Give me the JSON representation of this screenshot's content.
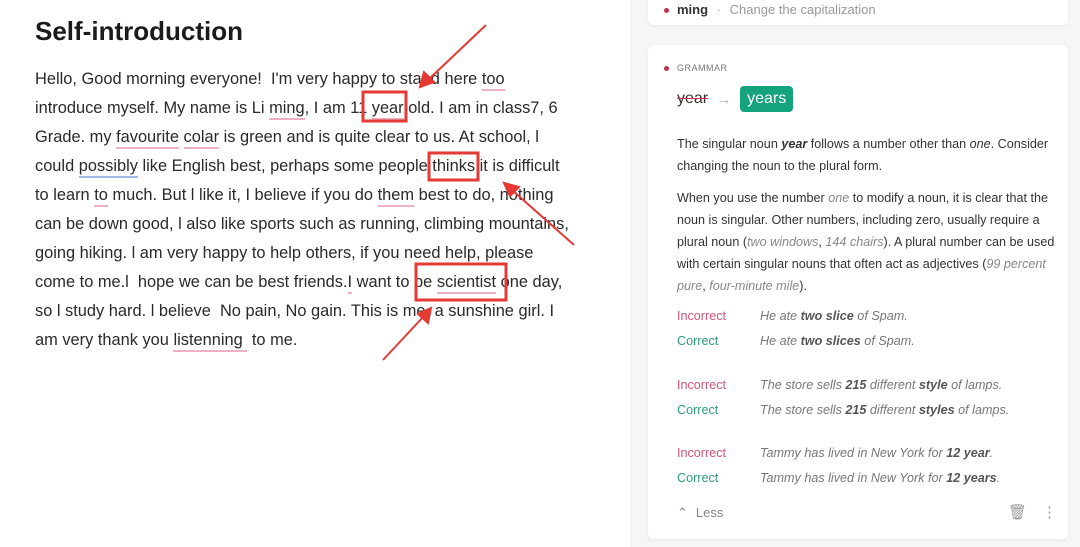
{
  "document": {
    "title": "Self-introduction",
    "lines": [
      [
        {
          "t": "Hello, Good morning everyone!  I'm very happy to stand here "
        },
        {
          "t": "too",
          "m": "red"
        }
      ],
      [
        {
          "t": "introduce myself. My name is Li "
        },
        {
          "t": "ming",
          "m": "red"
        },
        {
          "t": ", I am 11 "
        },
        {
          "t": "year",
          "m": "red"
        },
        {
          "t": " old. I am in class7, 6"
        }
      ],
      [
        {
          "t": "Grade. my "
        },
        {
          "t": "favourite",
          "m": "red"
        },
        {
          "t": " "
        },
        {
          "t": "colar",
          "m": "red"
        },
        {
          "t": " is green and is quite clear to us. At school, l"
        }
      ],
      [
        {
          "t": "could "
        },
        {
          "t": "possibly",
          "m": "blue"
        },
        {
          "t": " like English best, perhaps some people "
        },
        {
          "t": "thinks"
        },
        {
          "t": " it is difficult"
        }
      ],
      [
        {
          "t": "to learn "
        },
        {
          "t": "to",
          "m": "red"
        },
        {
          "t": " much. But l like it, I believe if you do "
        },
        {
          "t": "them",
          "m": "red"
        },
        {
          "t": " best to do, nothing"
        }
      ],
      [
        {
          "t": "can be down good, l also like sports such as running, climbing mountains,"
        }
      ],
      [
        {
          "t": "going hiking. l am very happy to help others, if you need help, please"
        }
      ],
      [
        {
          "t": "come to me.l  hope we can be best friends."
        },
        {
          "t": "I",
          "m": "red"
        },
        {
          "t": " want to be "
        },
        {
          "t": "scientist",
          "m": "red"
        },
        {
          "t": " one day,"
        }
      ],
      [
        {
          "t": "so l study hard. l believe  No pain, No gain. This is me, a sunshine girl. I"
        }
      ],
      [
        {
          "t": "am very thank you "
        },
        {
          "t": "listenning ",
          "m": "red"
        },
        {
          "t": " to me."
        }
      ]
    ]
  },
  "annotation_color": "#e53935",
  "top_card": {
    "word": "ming",
    "sep": "·",
    "hint": "Change the capitalization"
  },
  "suggestion": {
    "category": "GRAMMAR",
    "original": "year",
    "replacement": "years",
    "accent": "#15a37d",
    "explanation1": {
      "a": "The singular noun ",
      "b": "year",
      "c": " follows a number other than ",
      "d": "one",
      "e": ". Consider changing the noun to the plural form."
    },
    "explanation2": {
      "a": "When you use the number ",
      "b": "one",
      "c": " to modify a noun, it is clear that the noun is singular. Other numbers, including zero, usually require a plural noun (",
      "d": "two windows",
      "e": ", ",
      "f": "144 chairs",
      "g": "). A plural number can be used with certain singular nouns that often act as adjectives (",
      "h": "99 percent pure",
      "i": ", ",
      "j": "four-minute mile",
      "k": ")."
    },
    "examples": [
      {
        "label": "Incorrect",
        "a": "He ate ",
        "b": "two slice",
        "c": " of Spam."
      },
      {
        "label": "Correct",
        "a": "He ate ",
        "b": "two slices",
        "c": " of Spam."
      },
      {
        "label": "Incorrect",
        "a": "The store sells ",
        "b": "215",
        "c": " different ",
        "d": "style",
        "e": " of lamps."
      },
      {
        "label": "Correct",
        "a": "The store sells ",
        "b": "215",
        "c": " different ",
        "d": "styles",
        "e": " of lamps."
      },
      {
        "label": "Incorrect",
        "a": "Tammy has lived in New York for ",
        "b": "12 year",
        "c": "."
      },
      {
        "label": "Correct",
        "a": "Tammy has lived in New York for ",
        "b": "12 years",
        "c": "."
      }
    ],
    "less_label": "Less"
  }
}
